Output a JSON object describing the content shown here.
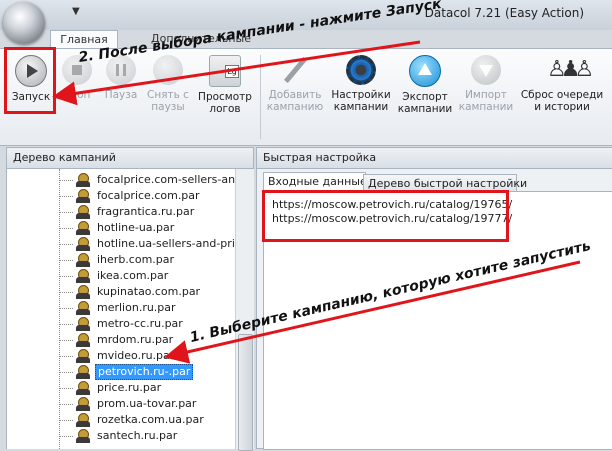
{
  "window": {
    "title": "Datacol 7.21 (Easy Action)",
    "qat_arrow": "▼"
  },
  "ribbon_tabs": {
    "active": "Главная",
    "inactive": "Дополнительные"
  },
  "ribbon": {
    "start": "Запуск",
    "stop": "Стоп",
    "pause": "Пауза",
    "unpause_1": "Снять с",
    "unpause_2": "паузы",
    "logs_1": "Просмотр",
    "logs_2": "логов",
    "logs_badge": "Lg",
    "add_1": "Добавить",
    "add_2": "кампанию",
    "settings_1": "Настройки",
    "settings_2": "кампании",
    "export_1": "Экспорт",
    "export_2": "кампании",
    "import_1": "Импорт",
    "import_2": "кампании",
    "reset_1": "Сброс очереди",
    "reset_2": "и истории"
  },
  "left_panel": {
    "title": "Дерево кампаний",
    "items": [
      "focalprice.com-sellers-and-",
      "focalprice.com.par",
      "fragrantica.ru.par",
      "hotline-ua.par",
      "hotline.ua-sellers-and-price",
      "iherb.com.par",
      "ikea.com.par",
      "kupinatao.com.par",
      "merlion.ru.par",
      "metro-cc.ru.par",
      "mrdom.ru.par",
      "mvideo.ru.par",
      "petrovich.ru-.par",
      "price.ru.par",
      "prom.ua-tovar.par",
      "rozetka.com.ua.par",
      "santech.ru.par"
    ],
    "selected_index": 12
  },
  "right_panel": {
    "title": "Быстрая настройка",
    "tab_active": "Входные данные",
    "tab_inactive": "Дерево быстрой настройки",
    "urls": [
      "https://moscow.petrovich.ru/catalog/19765/",
      "https://moscow.petrovich.ru/catalog/19777/"
    ]
  },
  "annotations": {
    "step2": "2. После выбора кампании - нажмите Запуск",
    "step1": "1. Выберите кампанию, которую хотите запустить"
  },
  "colors": {
    "annotation_red": "#e0151b",
    "selection_blue": "#3399ff"
  }
}
